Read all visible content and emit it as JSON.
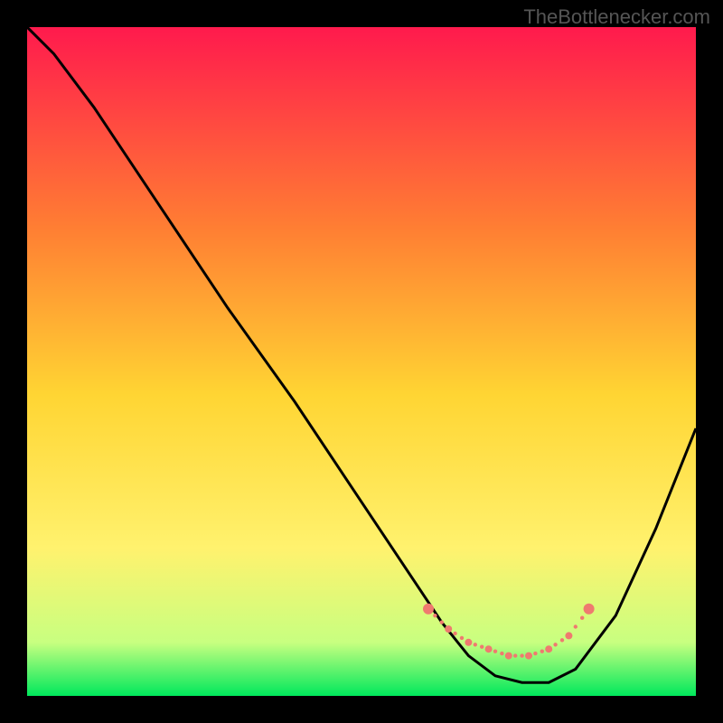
{
  "watermark": "TheBottlenecker.com",
  "chart_data": {
    "type": "line",
    "title": "",
    "xlabel": "",
    "ylabel": "",
    "xlim": [
      0,
      100
    ],
    "ylim": [
      0,
      100
    ],
    "background_gradient": {
      "top": "#ff1a4d",
      "upper_mid": "#ff7e33",
      "mid": "#ffd533",
      "lower_mid": "#fff26e",
      "bottom": "#c8ff80",
      "base": "#00e85c"
    },
    "series": [
      {
        "name": "bottleneck-curve",
        "color": "#000000",
        "x": [
          0,
          4,
          10,
          20,
          30,
          40,
          50,
          58,
          62,
          66,
          70,
          74,
          78,
          82,
          88,
          94,
          100
        ],
        "y": [
          100,
          96,
          88,
          73,
          58,
          44,
          29,
          17,
          11,
          6,
          3,
          2,
          2,
          4,
          12,
          25,
          40
        ]
      },
      {
        "name": "optimal-band",
        "color": "#ef7a6f",
        "style": "dotted",
        "x": [
          60,
          63,
          66,
          69,
          72,
          75,
          78,
          81,
          84
        ],
        "y": [
          13,
          10,
          8,
          7,
          6,
          6,
          7,
          9,
          13
        ]
      }
    ]
  }
}
